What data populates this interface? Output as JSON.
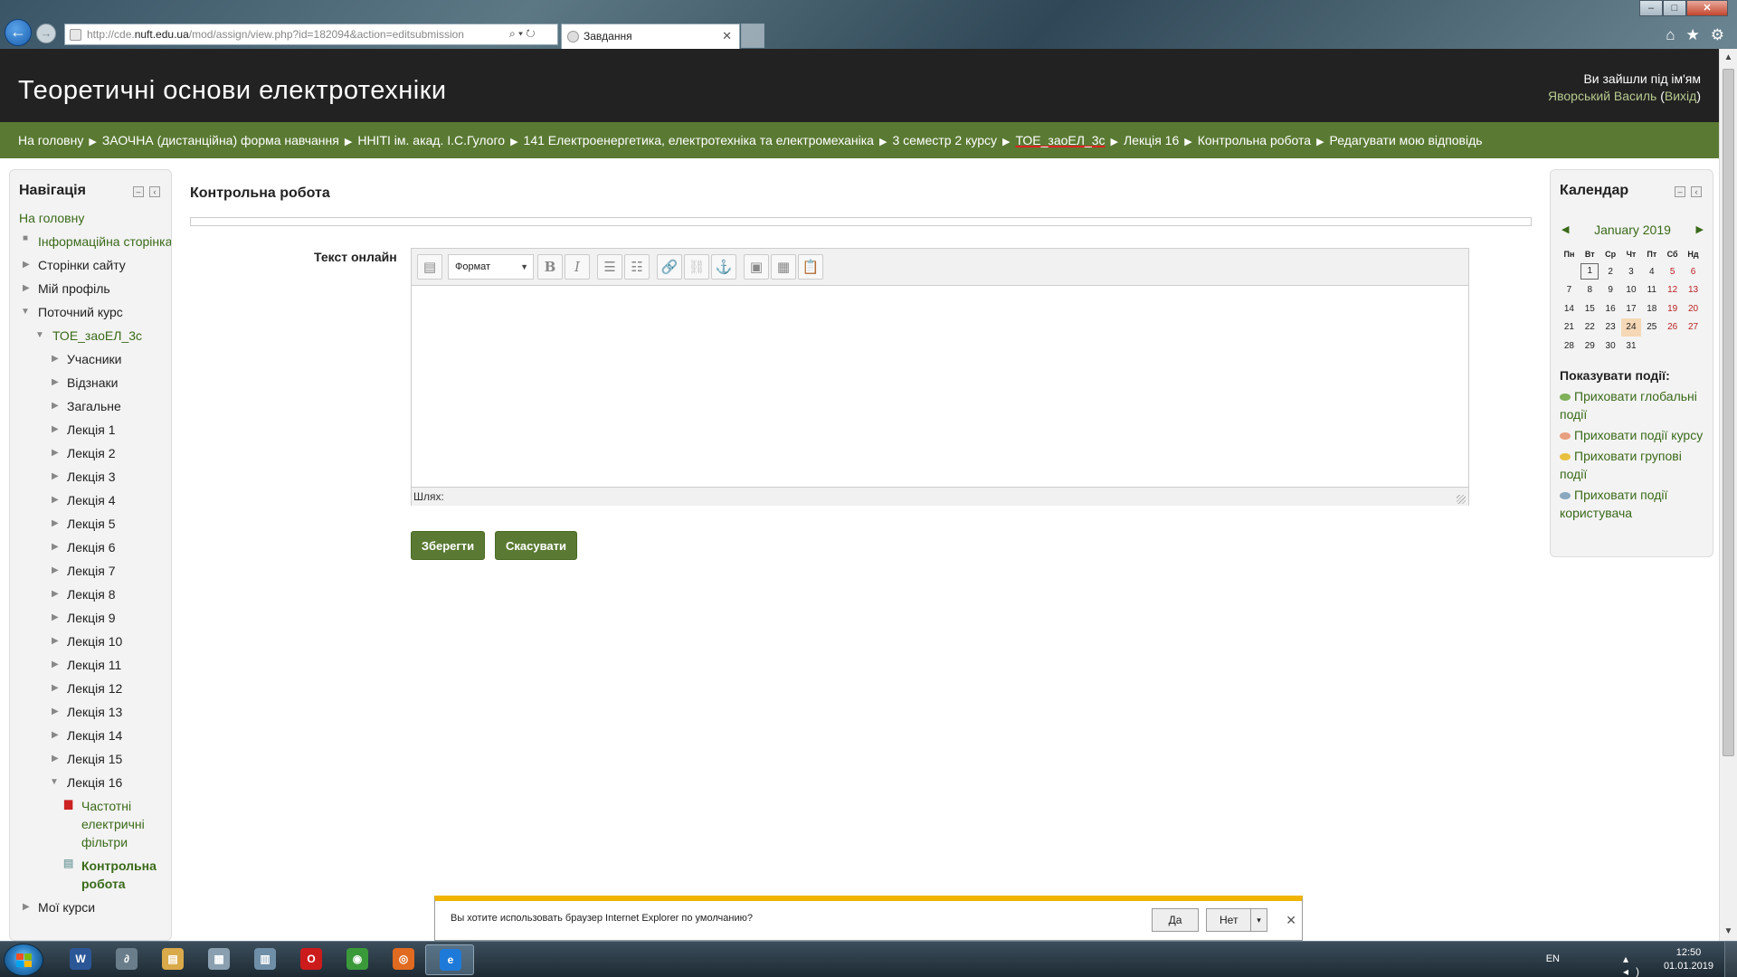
{
  "browser": {
    "url_prefix": "http://cde.",
    "url_host": "nuft.edu.ua",
    "url_rest": "/mod/assign/view.php?id=182094&action=editsubmission",
    "url_tools": "⌕ ▾ ↻",
    "tab_title": "Завдання",
    "tab_close": "✕",
    "back_glyph": "←",
    "forward_glyph": "→",
    "home_glyph": "⌂",
    "favorites_glyph": "★",
    "tools_glyph": "⚙",
    "win_min": "–",
    "win_max": "□",
    "win_close": "✕"
  },
  "header": {
    "site_title": "Теоретичні основи електротехніки",
    "login_prefix": "Ви зайшли під ім'ям",
    "user_name": "Яворський Василь",
    "logout_open": " (",
    "logout_label": "Вихід",
    "logout_close": ")"
  },
  "breadcrumb": {
    "separator": "▶",
    "items": [
      "На головну",
      "ЗАОЧНА (дистанційна) форма навчання",
      "ННІТІ ім. акад. І.С.Гулого",
      "141 Електроенергетика, електротехніка та електромеханіка",
      "3 семестр 2 курсу",
      "ТОЕ_заоЕЛ_3с",
      "Лекція 16",
      "Контрольна робота",
      "Редагувати мою відповідь"
    ]
  },
  "navigation": {
    "title": "Навігація",
    "ctrl_collapse": "–",
    "ctrl_dock": "‹",
    "items": [
      {
        "label": "На головну"
      },
      {
        "label": "Інформаційна сторінка"
      },
      {
        "label": "Сторінки сайту"
      },
      {
        "label": "Мій профіль"
      },
      {
        "label": "Поточний курс"
      },
      {
        "label": "ТОЕ_заоЕЛ_3с"
      },
      {
        "label": "Учасники"
      },
      {
        "label": "Відзнаки"
      },
      {
        "label": "Загальне"
      },
      {
        "label": "Лекція 1"
      },
      {
        "label": "Лекція 2"
      },
      {
        "label": "Лекція 3"
      },
      {
        "label": "Лекція 4"
      },
      {
        "label": "Лекція 5"
      },
      {
        "label": "Лекція 6"
      },
      {
        "label": "Лекція 7"
      },
      {
        "label": "Лекція 8"
      },
      {
        "label": "Лекція 9"
      },
      {
        "label": "Лекція 10"
      },
      {
        "label": "Лекція 11"
      },
      {
        "label": "Лекція 12"
      },
      {
        "label": "Лекція 13"
      },
      {
        "label": "Лекція 14"
      },
      {
        "label": "Лекція 15"
      },
      {
        "label": "Лекція 16"
      },
      {
        "label": "Частотні електричні фільтри"
      },
      {
        "label": "Контрольна робота"
      },
      {
        "label": "Мої курси"
      }
    ]
  },
  "main": {
    "page_heading": "Контрольна робота",
    "field_label": "Текст онлайн",
    "format_select": "Формат",
    "path_label": "Шлях:",
    "save_button": "Зберегти",
    "cancel_button": "Скасувати",
    "toolbar": {
      "bold": "B",
      "italic": "I",
      "bullets": "☰",
      "numbered": "☷",
      "link": "🔗",
      "unlink": "⛓",
      "anchor": "⚓",
      "image": "▣",
      "media": "▦",
      "paste": "📋",
      "toggle": "▤"
    }
  },
  "calendar": {
    "title": "Календар",
    "ctrl_collapse": "–",
    "ctrl_dock": "‹",
    "prev_glyph": "◀",
    "next_glyph": "▶",
    "month": "January 2019",
    "weekdays": [
      "Пн",
      "Вт",
      "Ср",
      "Чт",
      "Пт",
      "Сб",
      "Нд"
    ],
    "weeks": [
      [
        "",
        "1",
        "2",
        "3",
        "4",
        "5",
        "6"
      ],
      [
        "7",
        "8",
        "9",
        "10",
        "11",
        "12",
        "13"
      ],
      [
        "14",
        "15",
        "16",
        "17",
        "18",
        "19",
        "20"
      ],
      [
        "21",
        "22",
        "23",
        "24",
        "25",
        "26",
        "27"
      ],
      [
        "28",
        "29",
        "30",
        "31",
        "",
        "",
        ""
      ]
    ],
    "today": "1",
    "highlighted": "24",
    "events_title": "Показувати події:",
    "events": [
      {
        "label": "Приховати глобальні події",
        "color": "#7fb05a"
      },
      {
        "label": "Приховати події курсу",
        "color": "#e8a080"
      },
      {
        "label": "Приховати групові події",
        "color": "#e8c040"
      },
      {
        "label": "Приховати події користувача",
        "color": "#8aa8c0"
      }
    ]
  },
  "notification": {
    "message": "Вы хотите использовать браузер Internet Explorer по умолчанию?",
    "yes": "Да",
    "no": "Нет",
    "dropdown_glyph": "▾",
    "close_glyph": "✕"
  },
  "taskbar": {
    "apps": [
      {
        "name": "word",
        "glyph": "W",
        "color": "#2b5797"
      },
      {
        "name": "mathcad",
        "glyph": "∂",
        "color": "#6a7d8a"
      },
      {
        "name": "explorer",
        "glyph": "▤",
        "color": "#d9a94a"
      },
      {
        "name": "calculator",
        "glyph": "▦",
        "color": "#8aa0b0"
      },
      {
        "name": "network",
        "glyph": "▥",
        "color": "#6f8fa8"
      },
      {
        "name": "opera",
        "glyph": "O",
        "color": "#cc1b1b"
      },
      {
        "name": "chrome",
        "glyph": "◉",
        "color": "#3a9a3a"
      },
      {
        "name": "app",
        "glyph": "◎",
        "color": "#e06a20"
      },
      {
        "name": "internet-explorer",
        "glyph": "e",
        "color": "#1e7ad8"
      }
    ],
    "lang": "EN",
    "tray_icons": "▴ ◂) ▭",
    "time": "12:50",
    "date": "01.01.2019"
  }
}
